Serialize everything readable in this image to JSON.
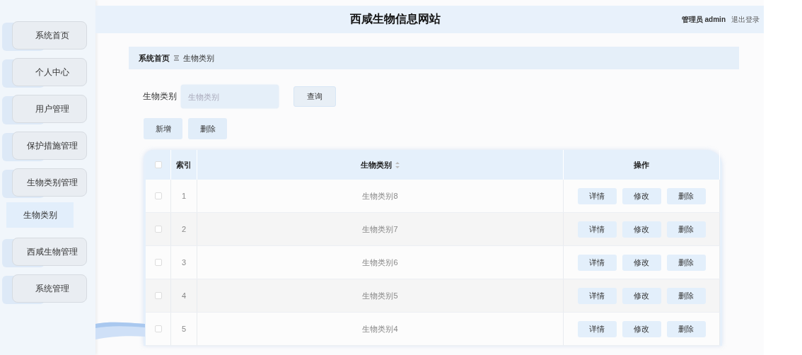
{
  "header": {
    "title": "西咸生物信息网站",
    "user": "管理员 admin",
    "logout": "退出登录"
  },
  "sidebar": {
    "items": [
      {
        "label": "系统首页"
      },
      {
        "label": "个人中心"
      },
      {
        "label": "用户管理"
      },
      {
        "label": "保护措施管理"
      },
      {
        "label": "生物类别管理",
        "children": [
          {
            "label": "生物类别",
            "selected": true
          }
        ]
      },
      {
        "label": "西咸生物管理"
      },
      {
        "label": "系统管理"
      }
    ]
  },
  "breadcrumb": [
    "系统首页",
    "生物类别"
  ],
  "search": {
    "label": "生物类别",
    "placeholder": "生物类别",
    "button": "查询"
  },
  "actions": [
    "新增",
    "删除"
  ],
  "table": {
    "header_checked": false,
    "columns": [
      {
        "label": "索引",
        "sortable": false
      },
      {
        "label": "生物类别",
        "sortable": true
      },
      {
        "label": "操作",
        "sortable": false
      }
    ],
    "rows": [
      {
        "checked": false,
        "index": "1",
        "name": "生物类别8",
        "actions": [
          "详情",
          "修改",
          "删除"
        ]
      },
      {
        "checked": false,
        "index": "2",
        "name": "生物类别7",
        "actions": [
          "详情",
          "修改",
          "删除"
        ]
      },
      {
        "checked": false,
        "index": "3",
        "name": "生物类别6",
        "actions": [
          "详情",
          "修改",
          "删除"
        ]
      },
      {
        "checked": false,
        "index": "4",
        "name": "生物类别5",
        "actions": [
          "详情",
          "修改",
          "删除"
        ]
      },
      {
        "checked": false,
        "index": "5",
        "name": "生物类别4",
        "actions": [
          "详情",
          "修改",
          "删除"
        ]
      }
    ]
  }
}
